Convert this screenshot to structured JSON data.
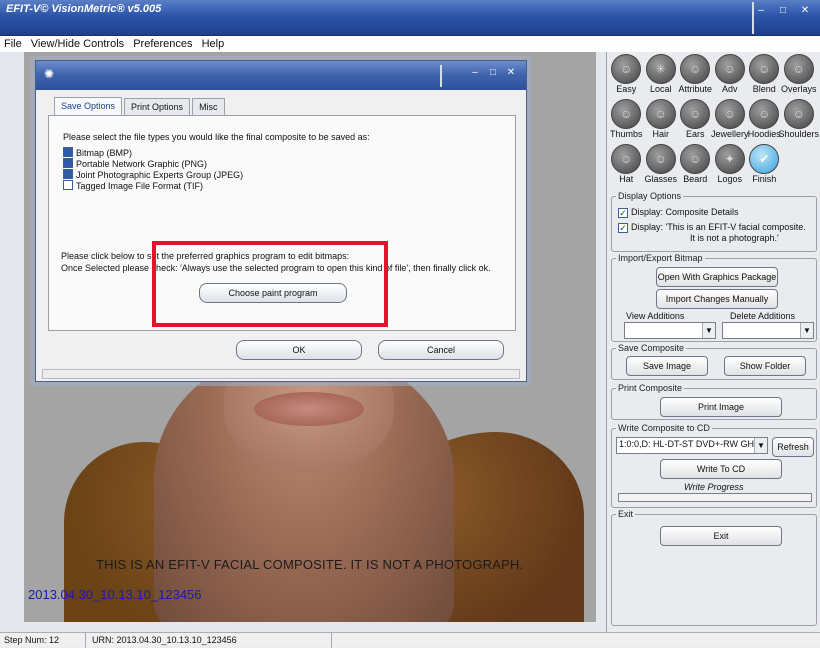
{
  "window": {
    "title": "EFIT-V© VisionMetric® v5.005",
    "min": "–",
    "max": "□",
    "close": "✕"
  },
  "menu": [
    "File",
    "View/Hide Controls",
    "Preferences",
    "Help"
  ],
  "tools": [
    [
      "Easy",
      "Local",
      "Attribute",
      "Adv",
      "Blend",
      "Overlays"
    ],
    [
      "Thumbs",
      "Hair",
      "Ears",
      "Jewellery",
      "Hoodies",
      "Shoulders"
    ],
    [
      "Hat",
      "Glasses",
      "Beard",
      "Logos",
      "Finish"
    ]
  ],
  "display_options": {
    "title": "Display Options",
    "opt1": "Display: Composite Details",
    "opt2_line1": "Display: 'This is an EFIT-V facial composite.",
    "opt2_line2": "It is not a photograph.'"
  },
  "import_export": {
    "title": "Import/Export Bitmap",
    "open_btn": "Open With Graphics Package",
    "import_btn": "Import Changes Manually",
    "view_additions": "View Additions",
    "delete_additions": "Delete Additions"
  },
  "save_composite": {
    "title": "Save Composite",
    "save_btn": "Save Image",
    "folder_btn": "Show Folder"
  },
  "print_composite": {
    "title": "Print Composite",
    "print_btn": "Print Image"
  },
  "write_cd": {
    "title": "Write Composite to CD",
    "drive": "1:0:0,D: HL-DT-ST DVD+-RW GH",
    "refresh_btn": "Refresh",
    "write_btn": "Write To CD",
    "progress_label": "Write Progress"
  },
  "exit_group": {
    "title": "Exit",
    "exit_btn": "Exit"
  },
  "composite": {
    "caption": "THIS IS AN EFIT-V FACIAL COMPOSITE. IT IS NOT A PHOTOGRAPH.",
    "urn_overlay": "2013.04.30_10.13.10_123456"
  },
  "status": {
    "step": "Step Num: 12",
    "urn": "URN: 2013.04.30_10.13.10_123456"
  },
  "dialog": {
    "tabs": [
      "Save Options",
      "Print Options",
      "Misc"
    ],
    "prompt": "Please select the file types you would like the final composite to be saved as:",
    "filetypes": [
      {
        "label": "Bitmap (BMP)",
        "checked": true
      },
      {
        "label": "Portable Network Graphic (PNG)",
        "checked": true
      },
      {
        "label": "Joint Photographic Experts Group (JPEG)",
        "checked": true
      },
      {
        "label": "Tagged Image File Format (TIF)",
        "checked": false
      }
    ],
    "instr1": "Please click below to set the preferred graphics program to edit bitmaps:",
    "instr2": "Once Selected please check: 'Always use the selected program to open this kind of file', then finally click ok.",
    "choose_btn": "Choose paint program",
    "ok_btn": "OK",
    "cancel_btn": "Cancel"
  },
  "colors": {
    "titlebar": "#2c55a8",
    "highlight": "#e8112d",
    "hood": "#6a4216"
  }
}
